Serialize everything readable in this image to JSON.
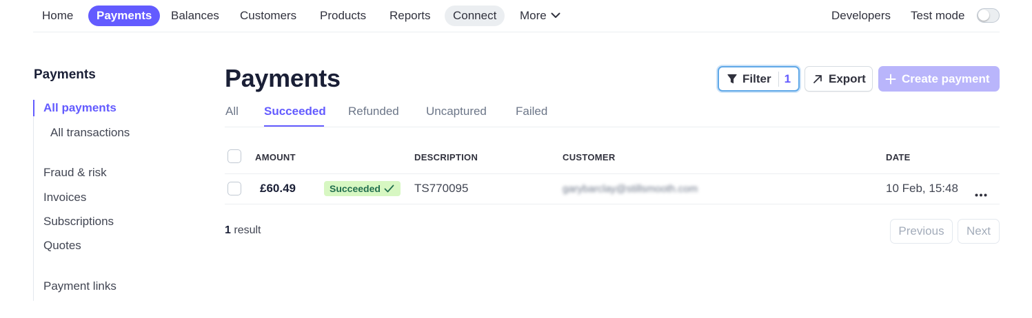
{
  "nav": {
    "items": [
      {
        "label": "Home"
      },
      {
        "label": "Payments"
      },
      {
        "label": "Balances"
      },
      {
        "label": "Customers"
      },
      {
        "label": "Products"
      },
      {
        "label": "Reports"
      },
      {
        "label": "Connect"
      },
      {
        "label": "More"
      }
    ],
    "developers": "Developers",
    "test_mode": "Test mode",
    "test_mode_on": false
  },
  "sidebar": {
    "title": "Payments",
    "items": [
      {
        "label": "All payments"
      },
      {
        "label": "All transactions"
      },
      {
        "label": "Fraud & risk"
      },
      {
        "label": "Invoices"
      },
      {
        "label": "Subscriptions"
      },
      {
        "label": "Quotes"
      },
      {
        "label": "Payment links"
      }
    ]
  },
  "header": {
    "title": "Payments",
    "filter_label": "Filter",
    "filter_count": "1",
    "export_label": "Export",
    "create_label": "Create payment"
  },
  "tabs": [
    {
      "label": "All"
    },
    {
      "label": "Succeeded"
    },
    {
      "label": "Refunded"
    },
    {
      "label": "Uncaptured"
    },
    {
      "label": "Failed"
    }
  ],
  "table": {
    "columns": [
      "AMOUNT",
      "DESCRIPTION",
      "CUSTOMER",
      "DATE"
    ],
    "rows": [
      {
        "amount": "£60.49",
        "status": "Succeeded",
        "description": "TS770095",
        "customer": "garybarclay@stillsmooth.com",
        "date": "10 Feb, 15:48"
      }
    ]
  },
  "footer": {
    "result_count": "1",
    "result_label": "result",
    "previous_label": "Previous",
    "next_label": "Next"
  },
  "colors": {
    "accent": "#635bff",
    "success_bg": "#d7f7c2",
    "success_text": "#216e4e"
  }
}
